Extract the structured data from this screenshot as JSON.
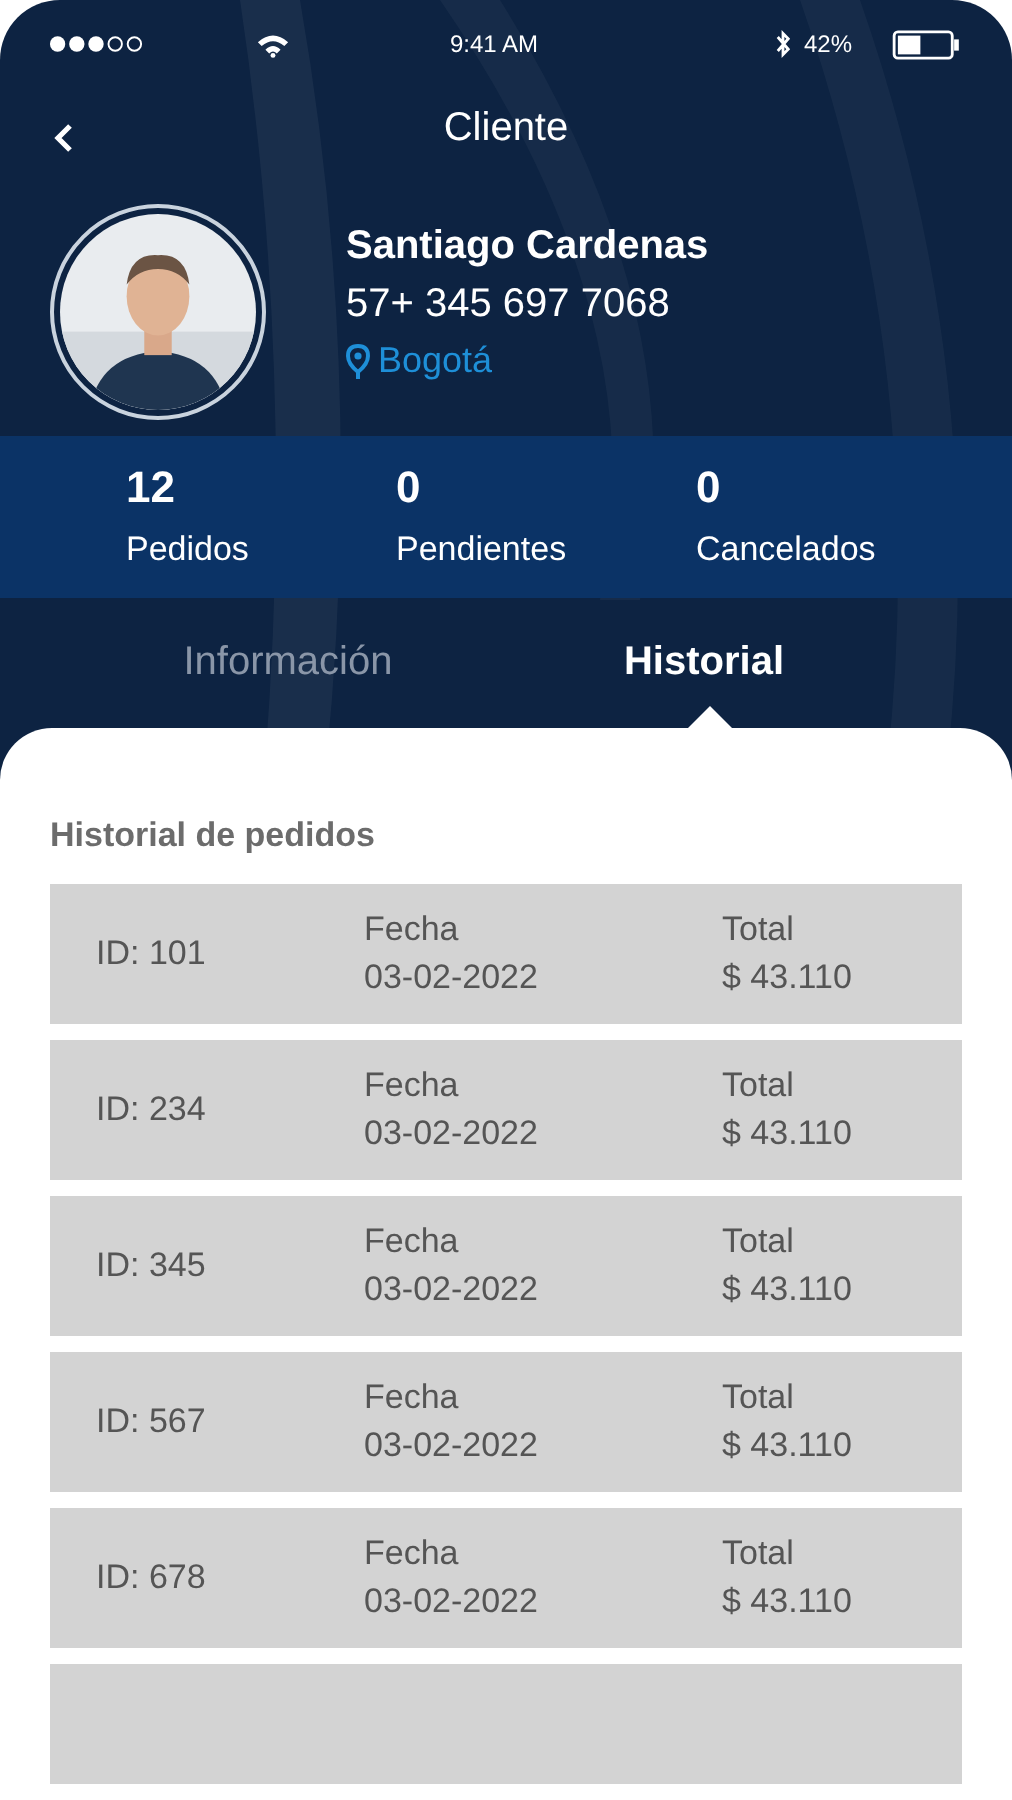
{
  "status_bar": {
    "time": "9:41 AM",
    "battery": "42%"
  },
  "header": {
    "title": "Cliente"
  },
  "profile": {
    "name": "Santiago Cardenas",
    "phone": "57+ 345 697 7068",
    "city": "Bogotá"
  },
  "stats": [
    {
      "value": "12",
      "label": "Pedidos"
    },
    {
      "value": "0",
      "label": "Pendientes"
    },
    {
      "value": "0",
      "label": "Cancelados"
    }
  ],
  "tabs": [
    {
      "label": "Información",
      "selected": false
    },
    {
      "label": "Historial",
      "selected": true
    }
  ],
  "history": {
    "title": "Historial de pedidos",
    "orders": [
      {
        "id": "ID: 101",
        "date_label": "Fecha",
        "date": "03-02-2022",
        "total_label": "Total",
        "total": "$ 43.110"
      },
      {
        "id": "ID: 234",
        "date_label": "Fecha",
        "date": "03-02-2022",
        "total_label": "Total",
        "total": "$ 43.110"
      },
      {
        "id": "ID: 345",
        "date_label": "Fecha",
        "date": "03-02-2022",
        "total_label": "Total",
        "total": "$ 43.110"
      },
      {
        "id": "ID: 567",
        "date_label": "Fecha",
        "date": "03-02-2022",
        "total_label": "Total",
        "total": "$ 43.110"
      },
      {
        "id": "ID: 678",
        "date_label": "Fecha",
        "date": "03-02-2022",
        "total_label": "Total",
        "total": "$ 43.110"
      }
    ]
  }
}
